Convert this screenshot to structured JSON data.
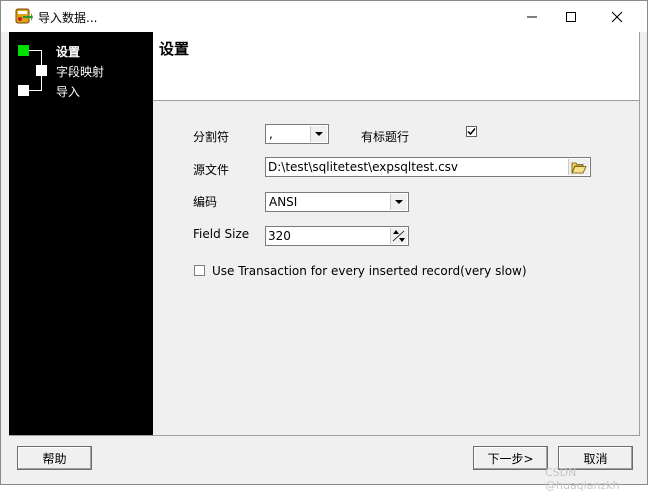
{
  "window": {
    "title": "导入数据...",
    "icon": "import-data-app-icon",
    "controls": [
      "minimize-icon",
      "maximize-icon",
      "close-icon"
    ]
  },
  "sidebar": {
    "steps": [
      {
        "label": "设置",
        "active": true
      },
      {
        "label": "字段映射",
        "active": false
      },
      {
        "label": "导入",
        "active": false
      }
    ],
    "colors": {
      "background": "#000000",
      "active_marker": "#00e000",
      "marker": "#ffffff"
    }
  },
  "header": {
    "title": "设置"
  },
  "form": {
    "delimiter": {
      "label": "分割符",
      "value": ","
    },
    "has_header": {
      "label": "有标题行",
      "checked": true
    },
    "source_file": {
      "label": "源文件",
      "value": "D:\\test\\sqlitetest\\expsqltest.csv",
      "button_icon": "folder-open-icon"
    },
    "encoding": {
      "label": "编码",
      "value": "ANSI"
    },
    "field_size": {
      "label": "Field Size",
      "value": "320"
    },
    "use_transaction": {
      "label": "Use Transaction for every inserted record(very slow)",
      "checked": false
    }
  },
  "footer": {
    "help_label": "帮助",
    "next_label": "下一步>",
    "cancel_label": "取消"
  },
  "watermark": "CSDN @huaqianzkh"
}
